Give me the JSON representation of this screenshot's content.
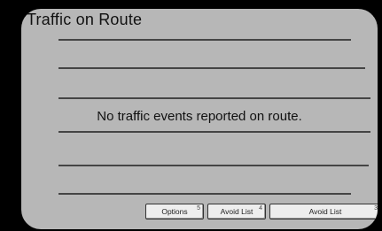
{
  "screen": {
    "title": "Traffic on Route",
    "message": "No traffic events reported on route."
  },
  "softkeys": [
    {
      "label": "Options",
      "corner": "5"
    },
    {
      "label": "Avoid List",
      "corner": "4"
    },
    {
      "label": "Avoid List",
      "corner": "3"
    }
  ],
  "colors": {
    "background": "#000000",
    "panel": "#d8d8d8",
    "text": "#111111"
  }
}
